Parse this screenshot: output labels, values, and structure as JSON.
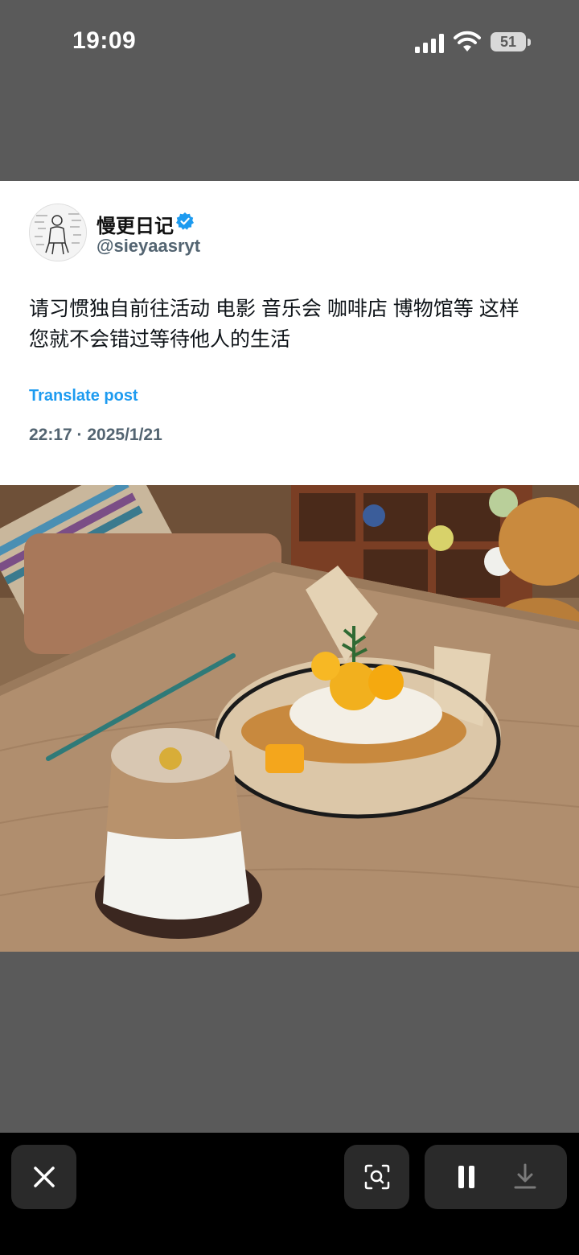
{
  "status_bar": {
    "time": "19:09",
    "battery_level": "51",
    "icons": [
      "cellular-signal-icon",
      "wifi-icon",
      "battery-icon"
    ]
  },
  "post": {
    "display_name": "慢更日记",
    "handle": "@sieyaasryt",
    "verified": true,
    "text_line1": "请习惯独自前往活动 电影 音乐会 咖啡店 博物馆等 这样",
    "text_line2": "您就不会错过等待他人的生活",
    "translate_label": "Translate post",
    "timestamp": "22:17 · 2025/1/21"
  },
  "colors": {
    "accent": "#1d9bf0",
    "secondary_text": "#536471",
    "backdrop": "#5a5a5a",
    "toolbar": "#000000",
    "button_bg": "#2a2a2a"
  },
  "toolbar": {
    "icons": [
      "close-icon",
      "visual-search-icon",
      "pause-icon",
      "download-icon"
    ]
  }
}
